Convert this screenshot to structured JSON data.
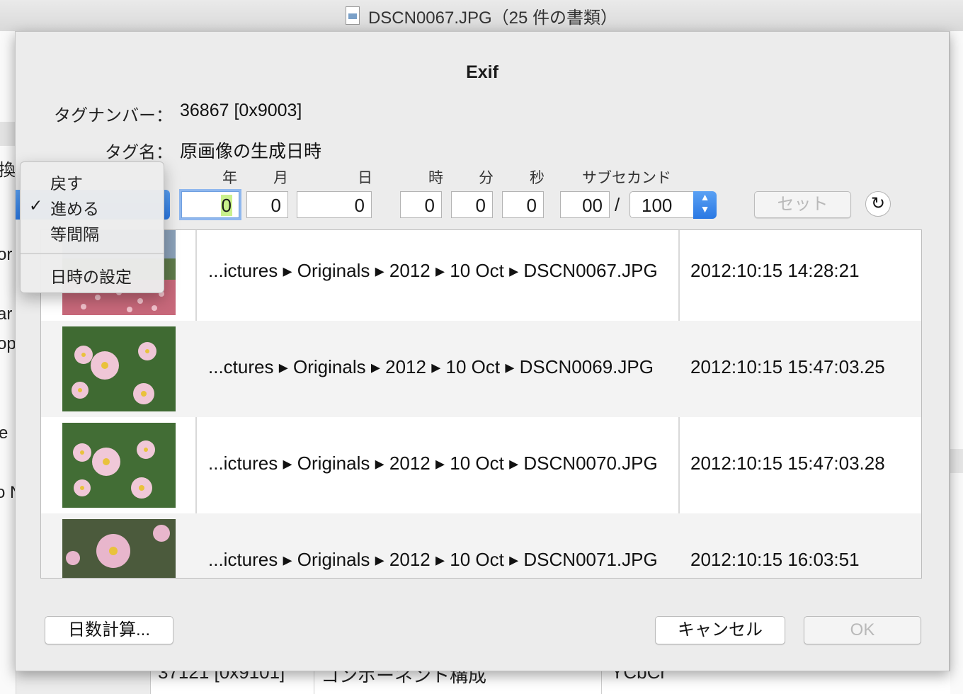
{
  "window": {
    "title": "DSCN0067.JPG（25 件の書類）"
  },
  "background": {
    "left_fragments": [
      "換",
      "or",
      "ar",
      "op",
      "e",
      "o N"
    ],
    "bottom_cells": [
      "37121 [0x9101]",
      "コンポーネント構成",
      "YCbCr"
    ]
  },
  "dialog": {
    "title": "Exif",
    "tag_number_label": "タグナンバー：",
    "tag_number_value": "36867 [0x9003]",
    "tag_name_label": "タグ名：",
    "tag_name_value": "原画像の生成日時",
    "columns": {
      "year": "年",
      "month": "月",
      "day": "日",
      "hour": "時",
      "minute": "分",
      "second": "秒",
      "subsecond": "サブセカンド"
    },
    "fields": {
      "year": "0",
      "month": "0",
      "day": "0",
      "hour": "0",
      "minute": "0",
      "second": "0",
      "subsecond": "00",
      "subsecond_denominator": "100"
    },
    "set_button": "セット",
    "reset_icon": "↻",
    "stepper_icon": "⌃⌄"
  },
  "menu": {
    "items": [
      "戻す",
      "進める",
      "等間隔",
      "日時の設定"
    ],
    "checked_item": "進める",
    "check_mark": "✓"
  },
  "files": [
    {
      "path": [
        "...ictures",
        "Originals",
        "2012",
        "10 Oct",
        "DSCN0067.JPG"
      ],
      "datetime": "2012:10:15 14:28:21"
    },
    {
      "path": [
        "...ctures",
        "Originals",
        "2012",
        "10 Oct",
        "DSCN0069.JPG"
      ],
      "datetime": "2012:10:15 15:47:03.25"
    },
    {
      "path": [
        "...ictures",
        "Originals",
        "2012",
        "10 Oct",
        "DSCN0070.JPG"
      ],
      "datetime": "2012:10:15 15:47:03.28"
    },
    {
      "path": [
        "...ictures",
        "Originals",
        "2012",
        "10 Oct",
        "DSCN0071.JPG"
      ],
      "datetime": "2012:10:15 16:03:51"
    }
  ],
  "path_separator": "▸",
  "footer": {
    "days_calc_button": "日数計算...",
    "cancel_button": "キャンセル",
    "ok_button": "OK"
  }
}
